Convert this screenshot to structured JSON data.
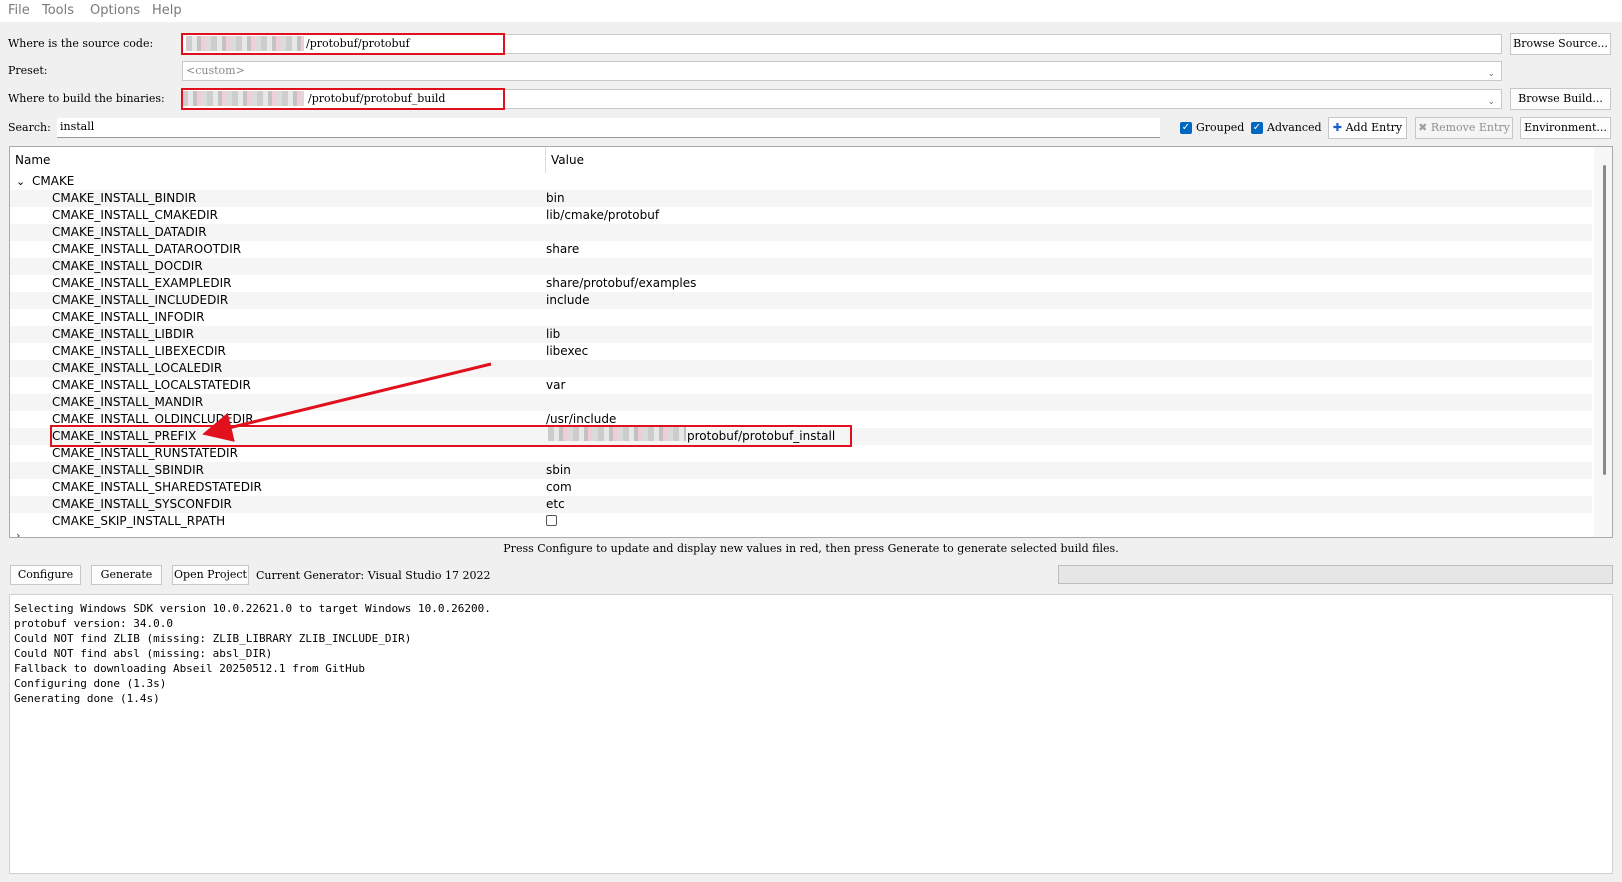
{
  "menu": [
    "File",
    "Tools",
    "Options",
    "Help"
  ],
  "source": {
    "label": "Where is the source code:",
    "value": "/protobuf/protobuf",
    "browse_label": "Browse Source..."
  },
  "preset": {
    "label": "Preset:",
    "value": "<custom>"
  },
  "build": {
    "label": "Where to build the binaries:",
    "value": "/protobuf/protobuf_build",
    "browse_label": "Browse Build..."
  },
  "search": {
    "label": "Search:",
    "value": "install"
  },
  "options": {
    "grouped_label": "Grouped",
    "grouped_checked": true,
    "advanced_label": "Advanced",
    "advanced_checked": true,
    "add_entry_label": "Add Entry",
    "remove_entry_label": "Remove Entry",
    "environment_label": "Environment..."
  },
  "table": {
    "col_name": "Name",
    "col_value": "Value",
    "group": "CMAKE",
    "rows": [
      {
        "name": "CMAKE_INSTALL_BINDIR",
        "value": "bin"
      },
      {
        "name": "CMAKE_INSTALL_CMAKEDIR",
        "value": "lib/cmake/protobuf"
      },
      {
        "name": "CMAKE_INSTALL_DATADIR",
        "value": ""
      },
      {
        "name": "CMAKE_INSTALL_DATAROOTDIR",
        "value": "share"
      },
      {
        "name": "CMAKE_INSTALL_DOCDIR",
        "value": ""
      },
      {
        "name": "CMAKE_INSTALL_EXAMPLEDIR",
        "value": "share/protobuf/examples"
      },
      {
        "name": "CMAKE_INSTALL_INCLUDEDIR",
        "value": "include"
      },
      {
        "name": "CMAKE_INSTALL_INFODIR",
        "value": ""
      },
      {
        "name": "CMAKE_INSTALL_LIBDIR",
        "value": "lib"
      },
      {
        "name": "CMAKE_INSTALL_LIBEXECDIR",
        "value": "libexec"
      },
      {
        "name": "CMAKE_INSTALL_LOCALEDIR",
        "value": ""
      },
      {
        "name": "CMAKE_INSTALL_LOCALSTATEDIR",
        "value": "var"
      },
      {
        "name": "CMAKE_INSTALL_MANDIR",
        "value": ""
      },
      {
        "name": "CMAKE_INSTALL_OLDINCLUDEDIR",
        "value": "/usr/include"
      },
      {
        "name": "CMAKE_INSTALL_PREFIX",
        "value": "protobuf/protobuf_install"
      },
      {
        "name": "CMAKE_INSTALL_RUNSTATEDIR",
        "value": ""
      },
      {
        "name": "CMAKE_INSTALL_SBINDIR",
        "value": "sbin"
      },
      {
        "name": "CMAKE_INSTALL_SHAREDSTATEDIR",
        "value": "com"
      },
      {
        "name": "CMAKE_INSTALL_SYSCONFDIR",
        "value": "etc"
      },
      {
        "name": "CMAKE_SKIP_INSTALL_RPATH",
        "value": ""
      }
    ]
  },
  "hint": "Press Configure to update and display new values in red, then press Generate to generate selected build files.",
  "actions": {
    "configure": "Configure",
    "generate": "Generate",
    "open_project": "Open Project",
    "generator": "Current Generator: Visual Studio 17 2022"
  },
  "output": [
    "Selecting Windows SDK version 10.0.22621.0 to target Windows 10.0.26200.",
    "protobuf version: 34.0.0",
    "Could NOT find ZLIB (missing: ZLIB_LIBRARY ZLIB_INCLUDE_DIR)",
    "Could NOT find absl (missing: absl_DIR)",
    "Fallback to downloading Abseil 20250512.1 from GitHub",
    "Configuring done (1.3s)",
    "Generating done (1.4s)"
  ],
  "colors": {
    "highlight": "#e0101c",
    "checkbox": "#0067c0"
  }
}
